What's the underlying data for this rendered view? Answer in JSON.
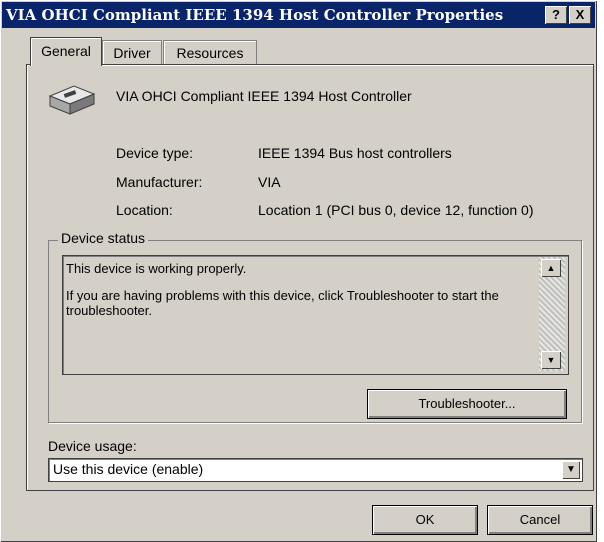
{
  "window": {
    "title": "VIA OHCI Compliant IEEE 1394 Host Controller Properties",
    "help_button": "?",
    "close_button": "X"
  },
  "tabs": [
    {
      "label": "General",
      "active": true
    },
    {
      "label": "Driver",
      "active": false
    },
    {
      "label": "Resources",
      "active": false
    }
  ],
  "device": {
    "name": "VIA OHCI Compliant IEEE 1394 Host Controller",
    "icon": "ieee1394-port-icon",
    "type_label": "Device type:",
    "type_value": "IEEE 1394 Bus host controllers",
    "manufacturer_label": "Manufacturer:",
    "manufacturer_value": "VIA",
    "location_label": "Location:",
    "location_value": "Location 1 (PCI bus 0, device 12, function 0)"
  },
  "status": {
    "group_title": "Device status",
    "line1": "This device is working properly.",
    "line2": "If you are having problems with this device, click Troubleshooter to start the troubleshooter.",
    "troubleshooter_label": "Troubleshooter..."
  },
  "usage": {
    "label": "Device usage:",
    "selected": "Use this device (enable)"
  },
  "buttons": {
    "ok": "OK",
    "cancel": "Cancel"
  }
}
